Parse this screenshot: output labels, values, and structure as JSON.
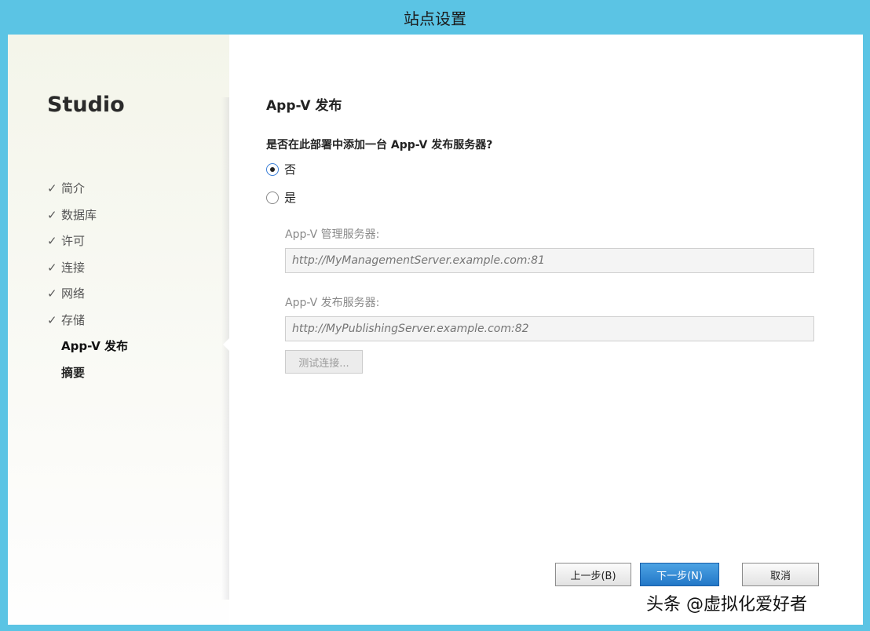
{
  "window": {
    "title": "站点设置"
  },
  "sidebar": {
    "brand": "Studio",
    "steps": [
      {
        "label": "简介",
        "done": true
      },
      {
        "label": "数据库",
        "done": true
      },
      {
        "label": "许可",
        "done": true
      },
      {
        "label": "连接",
        "done": true
      },
      {
        "label": "网络",
        "done": true
      },
      {
        "label": "存储",
        "done": true
      },
      {
        "label": "App-V 发布",
        "current": true
      },
      {
        "label": "摘要"
      }
    ],
    "check_glyph": "✓"
  },
  "main": {
    "title": "App-V 发布",
    "question": "是否在此部署中添加一台 App-V 发布服务器?",
    "options": [
      {
        "label": "否",
        "selected": true
      },
      {
        "label": "是",
        "selected": false
      }
    ],
    "management_label": "App-V 管理服务器:",
    "management_placeholder": "http://MyManagementServer.example.com:81",
    "publishing_label": "App-V 发布服务器:",
    "publishing_placeholder": "http://MyPublishingServer.example.com:82",
    "test_button": "测试连接..."
  },
  "footer": {
    "back": "上一步(B)",
    "next": "下一步(N)",
    "cancel": "取消"
  },
  "watermark": "头条 @虚拟化爱好者"
}
